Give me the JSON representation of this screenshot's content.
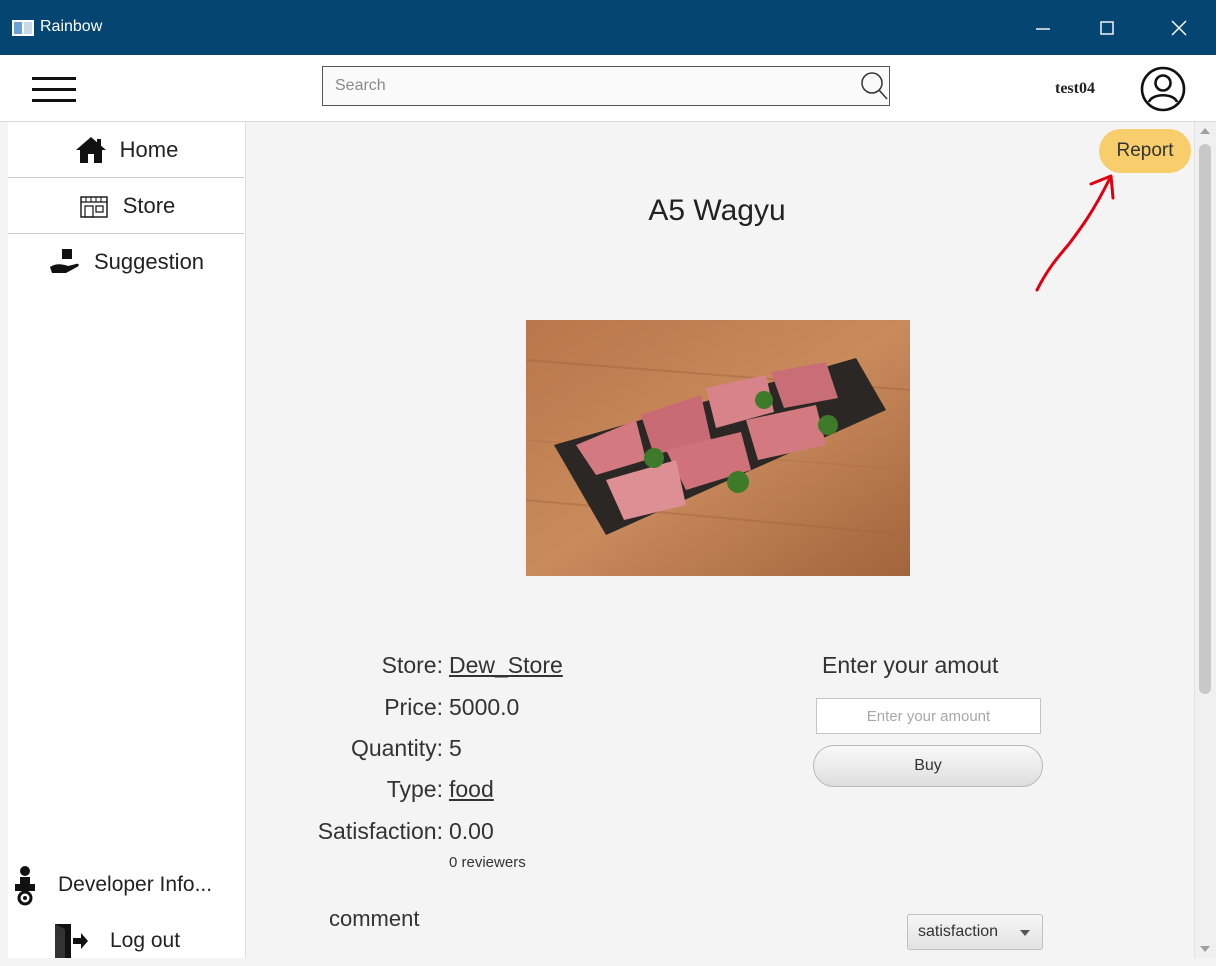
{
  "window": {
    "title": "Rainbow",
    "titlebar_color": "#044572",
    "minimize_icon": "minimize-icon",
    "maximize_icon": "maximize-icon",
    "close_icon": "close-icon"
  },
  "header": {
    "search_placeholder": "Search",
    "search_value": "",
    "username": "test04"
  },
  "sidebar": {
    "items": [
      {
        "label": "Home",
        "icon": "home-icon"
      },
      {
        "label": "Store",
        "icon": "store-icon"
      },
      {
        "label": "Suggestion",
        "icon": "suggestion-icon"
      }
    ],
    "bottom_items": [
      {
        "label": "Developer Info...",
        "icon": "developer-icon"
      },
      {
        "label": "Log out",
        "icon": "logout-icon"
      }
    ]
  },
  "main": {
    "report_label": "Report",
    "report_color": "#f7ce6b",
    "annotation_color": "#e0000f",
    "product_title": "A5 Wagyu",
    "details": {
      "store_label": "Store:",
      "store_value": "Dew_Store",
      "price_label": "Price:",
      "price_value": "5000.0",
      "quantity_label": "Quantity:",
      "quantity_value": "5",
      "type_label": "Type:",
      "type_value": "food",
      "satisfaction_label": "Satisfaction:",
      "satisfaction_value": "0.00",
      "reviewers": "0 reviewers"
    },
    "purchase": {
      "title": "Enter your amout",
      "amount_placeholder": "Enter your amount",
      "buy_label": "Buy"
    },
    "comment_label": "comment",
    "sort_selected": "satisfaction"
  }
}
